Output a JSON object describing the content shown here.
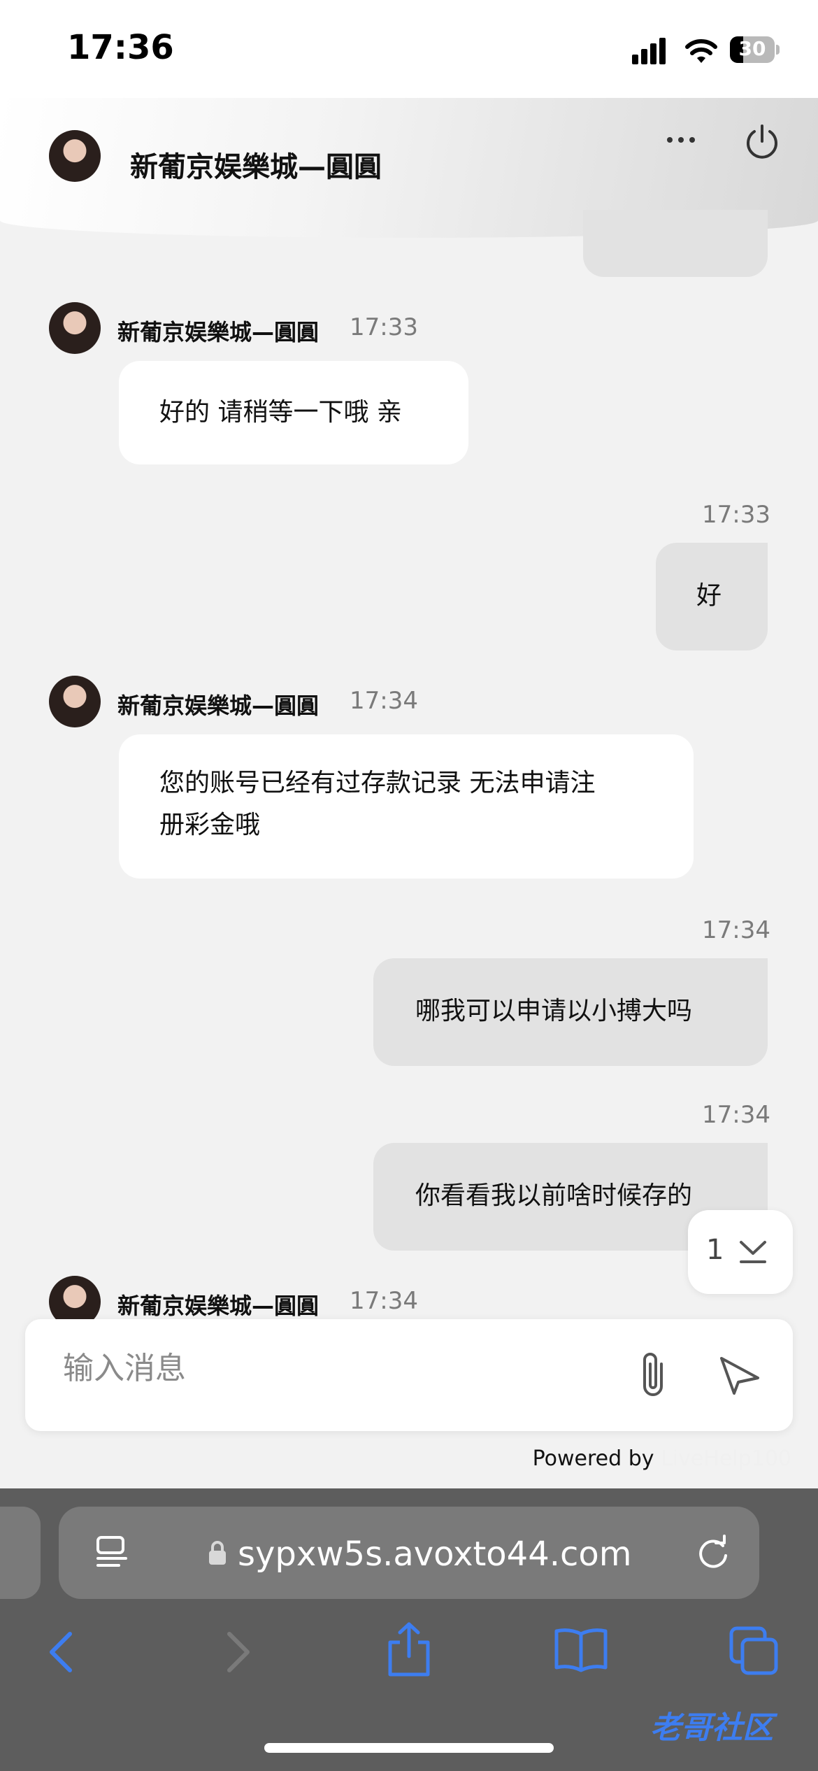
{
  "status_bar": {
    "time": "17:36",
    "battery": "30"
  },
  "header": {
    "title": "新葡京娱樂城—圓圓"
  },
  "messages": [
    {
      "direction": "in",
      "sender": "新葡京娱樂城—圓圓",
      "time": "17:33",
      "text": "好的 请稍等一下哦 亲"
    },
    {
      "direction": "out",
      "time": "17:33",
      "text": "好"
    },
    {
      "direction": "in",
      "sender": "新葡京娱樂城—圓圓",
      "time": "17:34",
      "line1": "您的账号已经有过存款记录 无法申请注",
      "line2": "册彩金哦"
    },
    {
      "direction": "out",
      "time": "17:34",
      "text": "哪我可以申请以小搏大吗"
    },
    {
      "direction": "out",
      "time": "17:34",
      "text": "你看看我以前啥时候存的"
    },
    {
      "direction": "in",
      "sender": "新葡京娱樂城—圓圓",
      "time": "17:34"
    }
  ],
  "scroll_badge": {
    "count": "1"
  },
  "composer": {
    "placeholder": "输入消息"
  },
  "footer": {
    "powered_by": "Powered by",
    "brand": "LiveHelp100"
  },
  "browser": {
    "url": "sypxw5s.avoxto44.com"
  },
  "watermark": "老哥社区",
  "colors": {
    "accent_blue": "#3d7df0",
    "bubble_out": "#e2e2e2",
    "bubble_in": "#ffffff"
  }
}
